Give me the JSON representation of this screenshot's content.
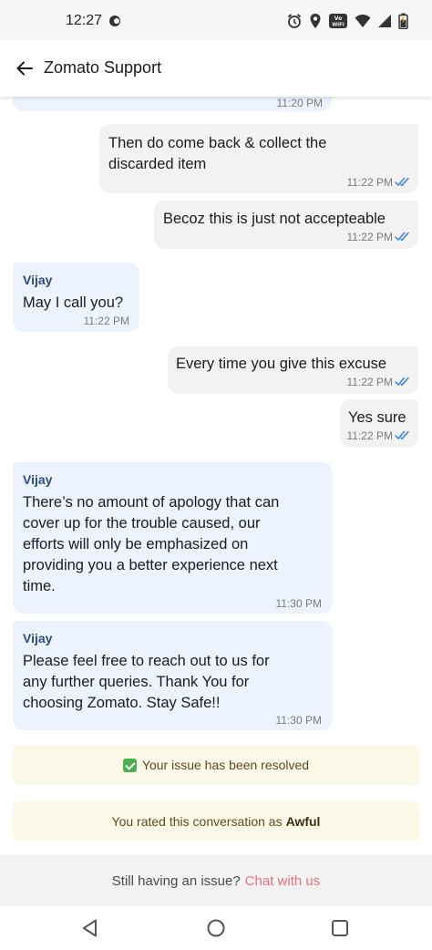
{
  "status_bar": {
    "time": "12:27",
    "icons": [
      "notification-dot-icon",
      "alarm-icon",
      "location-icon",
      "vowifi-icon",
      "wifi-icon",
      "signal-icon",
      "battery-icon"
    ],
    "vowifi_label": "Vo WiFi"
  },
  "header": {
    "title": "Zomato Support",
    "back_icon": "arrow-left-icon"
  },
  "messages": [
    {
      "direction": "in",
      "time": "11:20 PM"
    },
    {
      "direction": "out",
      "text": "Then do come back & collect the\ndiscarded item",
      "time": "11:22 PM",
      "read": true
    },
    {
      "direction": "out",
      "text": "Becoz this is just not accepteable",
      "time": "11:22 PM",
      "read": true
    },
    {
      "direction": "in",
      "sender": "Vijay",
      "text": "May I call you?",
      "time": "11:22 PM"
    },
    {
      "direction": "out",
      "text": "Every time you give this excuse",
      "time": "11:22 PM",
      "read": true
    },
    {
      "direction": "out",
      "text": "Yes sure",
      "time": "11:22 PM",
      "read": true
    },
    {
      "direction": "in",
      "sender": "Vijay",
      "text": "There’s no amount of apology that can\ncover up for the trouble caused, our\nefforts will only be emphasized on\nproviding you a better experience next\ntime.",
      "time": "11:30 PM"
    },
    {
      "direction": "in",
      "sender": "Vijay",
      "text": "Please feel free to reach out to us for\nany further queries. Thank You for\nchoosing Zomato. Stay Safe!!",
      "time": "11:30 PM"
    }
  ],
  "notices": {
    "resolved": "Your issue has been resolved",
    "rated_prefix": "You rated this conversation as",
    "rated_value": "Awful"
  },
  "footer": {
    "prompt": "Still having an issue?",
    "link": "Chat with us"
  },
  "nav": [
    "back-triangle-icon",
    "home-circle-icon",
    "recents-square-icon"
  ],
  "colors": {
    "incoming_bubble": "#ecf2fe",
    "outgoing_bubble": "#f2f2f2",
    "sender_name": "#2c4b7c",
    "read_tick": "#3d7fe0",
    "notice_bg": "#fdf9e9",
    "link": "#e8707e"
  }
}
